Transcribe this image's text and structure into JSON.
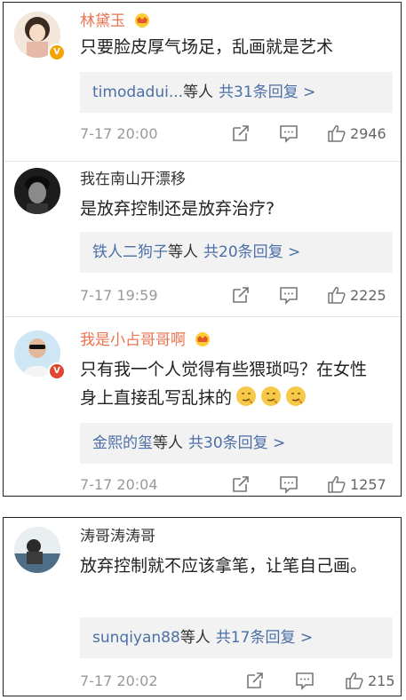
{
  "comments": [
    {
      "username": "林黛玉",
      "text": "只要脸皮厚气场足，乱画就是艺术",
      "reply_users": "timodadui...",
      "reply_suffix": "等人",
      "reply_count": "共31条回复 >",
      "time": "7-17 20:00",
      "likes": "2946"
    },
    {
      "username": "我在南山开漂移",
      "text": "是放弃控制还是放弃治疗?",
      "reply_users": "铁人二狗子",
      "reply_suffix": "等人",
      "reply_count": "共20条回复 >",
      "time": "7-17 19:59",
      "likes": "2225"
    },
    {
      "username": "我是小占哥哥啊",
      "text": "只有我一个人觉得有些猥琐吗？在女性身上直接乱写乱抹的",
      "reply_users": "金熙的玺",
      "reply_suffix": "等人",
      "reply_count": "共30条回复 >",
      "time": "7-17 20:04",
      "likes": "1257"
    },
    {
      "username": "涛哥涛涛哥",
      "text": "放弃控制就不应该拿笔，让笔自己画。",
      "reply_users": "sunqiyan88",
      "reply_suffix": "等人",
      "reply_count": "共17条回复 >",
      "time": "7-17 20:02",
      "likes": "215"
    }
  ],
  "icons": {
    "share": "share-icon",
    "comment": "comment-icon",
    "like": "thumbs-up-icon",
    "emoji": "smirk-emoji-icon",
    "vip": "vip-crown-icon",
    "verified": "verified-badge-icon"
  },
  "colors": {
    "vip_name": "#eb7350",
    "link": "#4c6fa7",
    "meta": "#999999",
    "verified": "#f4a300"
  }
}
